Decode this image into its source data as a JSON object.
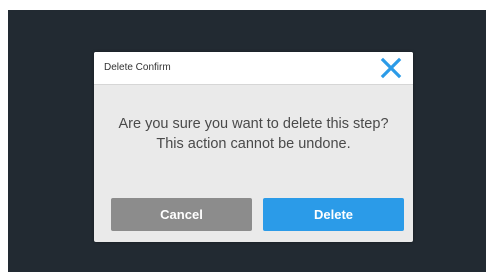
{
  "dialog": {
    "title": "Delete Confirm",
    "close_icon": "close-icon",
    "message": "Are you sure you want to delete this step? This action cannot be undone.",
    "cancel_label": "Cancel",
    "delete_label": "Delete"
  },
  "colors": {
    "background_dark": "#222a32",
    "close_icon": "#2b9be8",
    "cancel_button": "#8c8c8c",
    "delete_button": "#2b9be8"
  }
}
